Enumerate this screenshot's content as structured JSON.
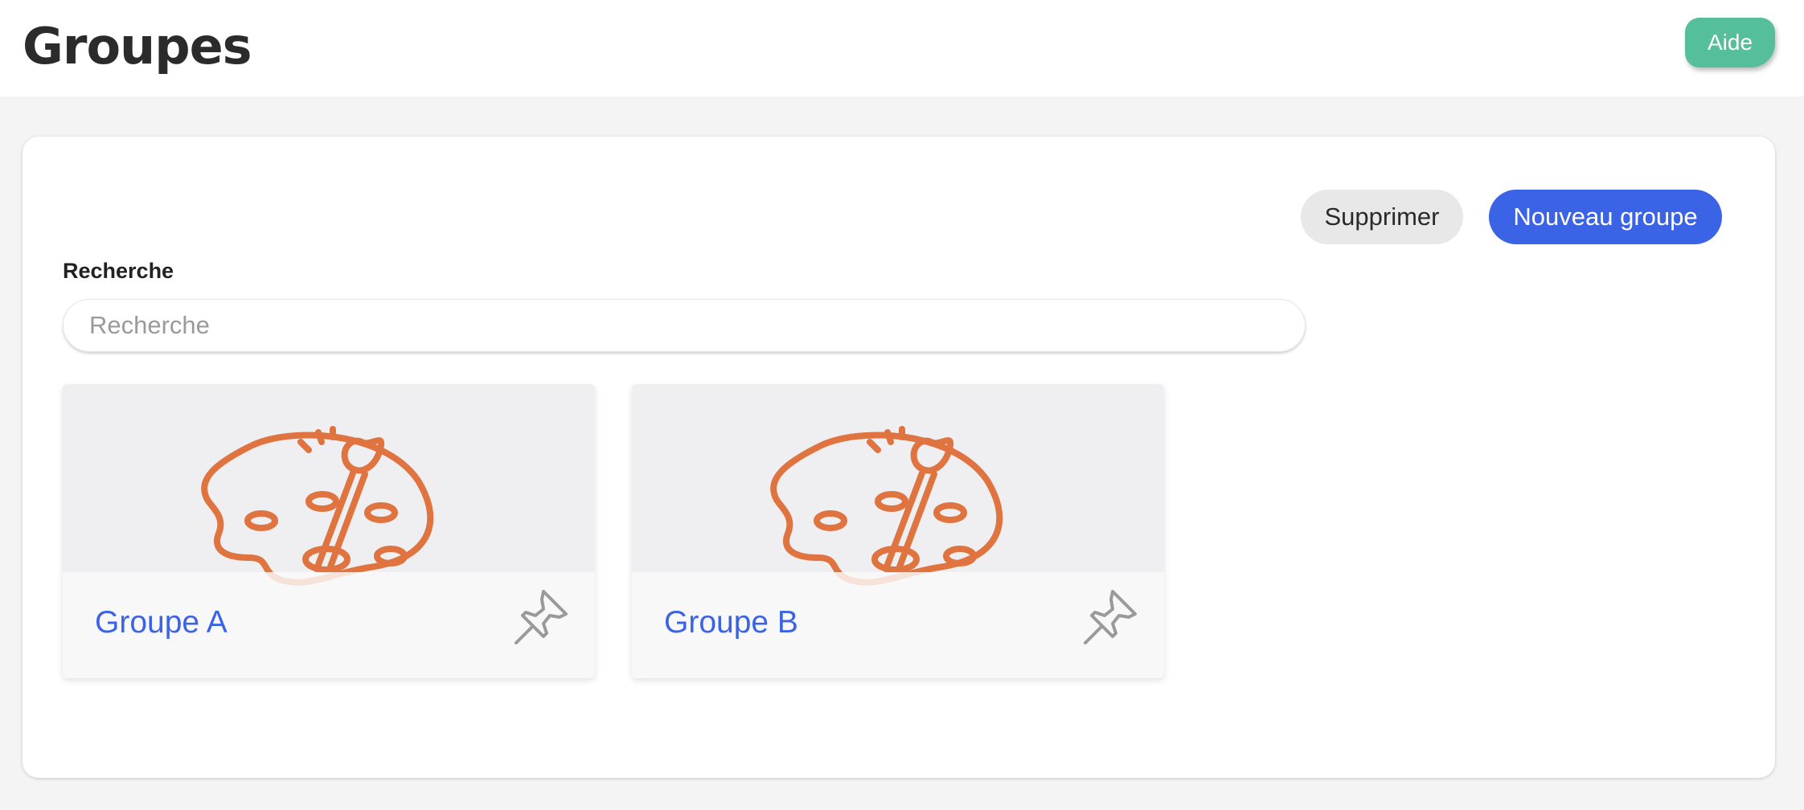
{
  "header": {
    "title": "Groupes",
    "help_label": "Aide"
  },
  "toolbar": {
    "delete_label": "Supprimer",
    "new_group_label": "Nouveau groupe"
  },
  "search": {
    "label": "Recherche",
    "placeholder": "Recherche",
    "value": ""
  },
  "groups": [
    {
      "name": "Groupe A",
      "illustration": "palette-brush-icon",
      "pin_icon": "pin-icon",
      "pinned": false
    },
    {
      "name": "Groupe B",
      "illustration": "palette-brush-icon",
      "pin_icon": "pin-icon",
      "pinned": false
    }
  ],
  "colors": {
    "accent": "#3b63e6",
    "help_button": "#55be9a",
    "illustration": "#e07440",
    "pin": "#9a9a9a"
  }
}
